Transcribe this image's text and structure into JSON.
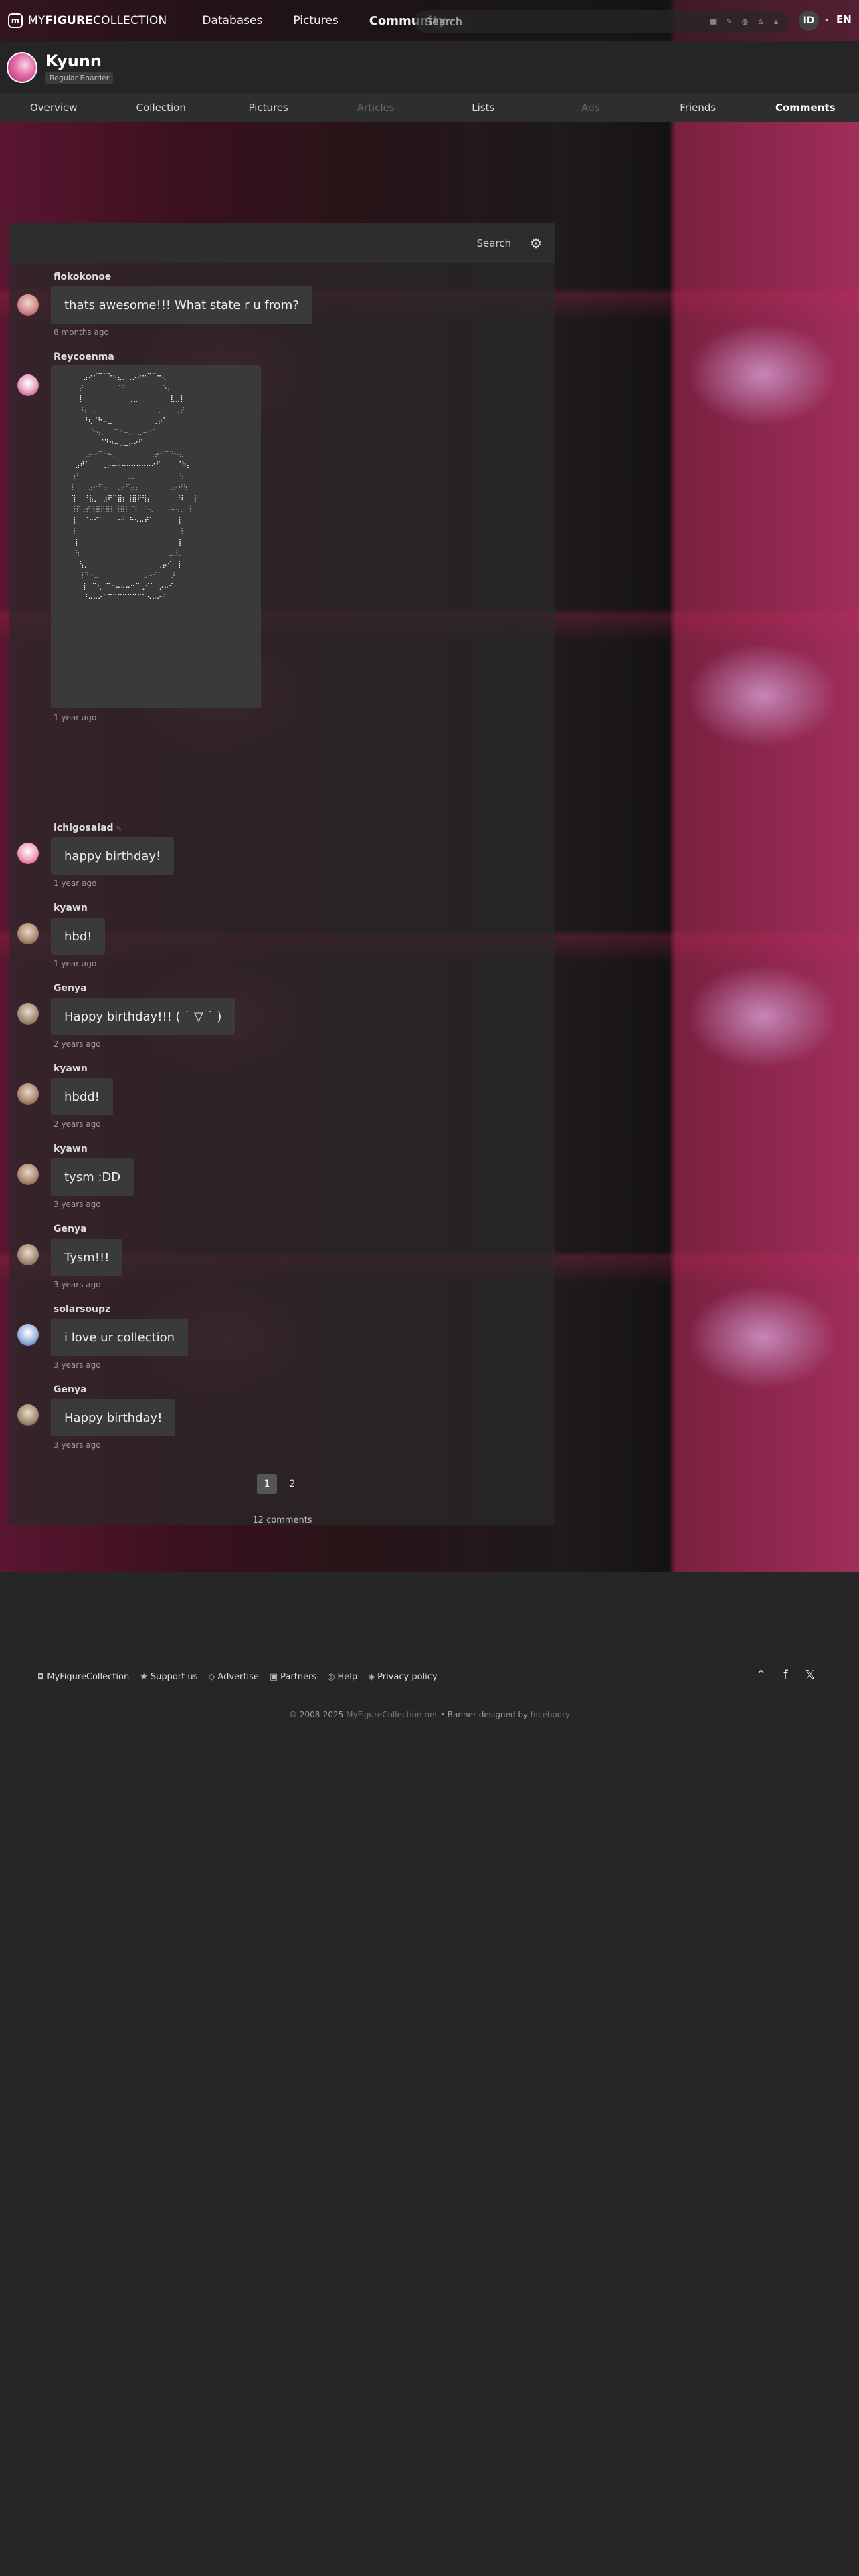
{
  "topbar": {
    "logo_prefix": "MY",
    "logo_bold": "FIGURE",
    "logo_suffix": "COLLECTION",
    "nav": [
      {
        "label": "Databases",
        "active": false
      },
      {
        "label": "Pictures",
        "active": false
      },
      {
        "label": "Community",
        "active": true
      }
    ],
    "search_placeholder": "Search",
    "user_initial": "ID",
    "language": "EN"
  },
  "profile": {
    "name": "Kyunn",
    "rank": "Regular Boarder"
  },
  "tabs": [
    {
      "label": "Overview",
      "state": "normal"
    },
    {
      "label": "Collection",
      "state": "normal"
    },
    {
      "label": "Pictures",
      "state": "normal"
    },
    {
      "label": "Articles",
      "state": "dim"
    },
    {
      "label": "Lists",
      "state": "normal"
    },
    {
      "label": "Ads",
      "state": "dim"
    },
    {
      "label": "Friends",
      "state": "normal"
    },
    {
      "label": "Comments",
      "state": "active"
    }
  ],
  "comments_panel": {
    "search_label": "Search",
    "comments": [
      {
        "author": "flokokonoe",
        "text": "thats awesome!!! What state r u from?",
        "time": "8 months ago"
      },
      {
        "author": "Reycoenma",
        "text": "",
        "time": "1 year ago",
        "ascii_art": true
      },
      {
        "author": "ichigosalad",
        "text": "happy birthday!",
        "time": "1 year ago"
      },
      {
        "author": "kyawn",
        "text": "hbd!",
        "time": "1 year ago"
      },
      {
        "author": "Genya",
        "text": "Happy birthday!!! ( ˙ ▽ ˙ )",
        "time": "2 years ago"
      },
      {
        "author": "kyawn",
        "text": "hbdd!",
        "time": "2 years ago"
      },
      {
        "author": "kyawn",
        "text": "tysm :DD",
        "time": "3 years ago"
      },
      {
        "author": "Genya",
        "text": "Tysm!!!",
        "time": "3 years ago"
      },
      {
        "author": "solarsoupz",
        "text": "i love ur collection",
        "time": "3 years ago"
      },
      {
        "author": "Genya",
        "text": "Happy birthday!",
        "time": "3 years ago"
      }
    ],
    "pages": [
      "1",
      "2"
    ],
    "current_page": "1",
    "count_label": "12 comments"
  },
  "footer": {
    "links": [
      {
        "icon": "mfc-icon",
        "label": "MyFigureCollection"
      },
      {
        "icon": "star-icon",
        "label": "Support us"
      },
      {
        "icon": "diamond-icon",
        "label": "Advertise"
      },
      {
        "icon": "handshake-icon",
        "label": "Partners"
      },
      {
        "icon": "help-icon",
        "label": "Help"
      },
      {
        "icon": "shield-icon",
        "label": "Privacy policy"
      }
    ],
    "copyright": "© 2008-2025",
    "site_link": "MyFigureCollection.net",
    "banner_text": "• Banner designed by",
    "designer": "hicebooty"
  }
}
